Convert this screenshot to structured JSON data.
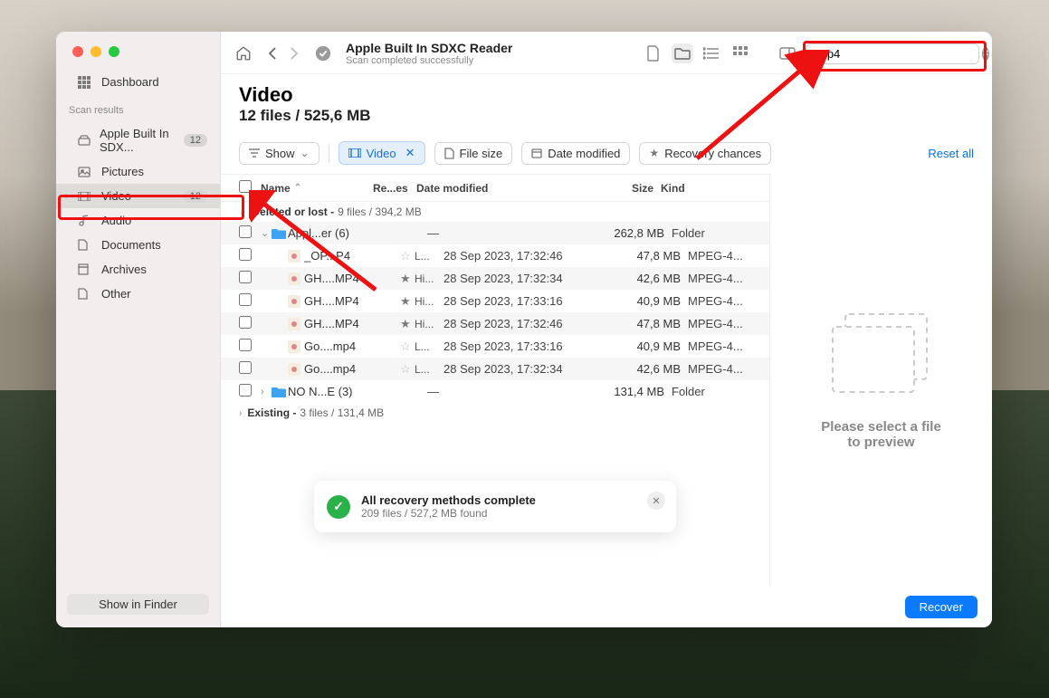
{
  "window": {
    "title": "Apple Built In SDXC Reader",
    "subtitle": "Scan completed successfully"
  },
  "search": {
    "value": "mp4"
  },
  "sidebar": {
    "dashboard": "Dashboard",
    "heading": "Scan results",
    "items": [
      {
        "label": "Apple Built In SDX...",
        "badge": "12",
        "icon": "drive"
      },
      {
        "label": "Pictures",
        "icon": "image"
      },
      {
        "label": "Video",
        "badge": "12",
        "icon": "video",
        "chev": true,
        "active": true
      },
      {
        "label": "Audio",
        "icon": "audio"
      },
      {
        "label": "Documents",
        "icon": "docs"
      },
      {
        "label": "Archives",
        "icon": "archive"
      },
      {
        "label": "Other",
        "icon": "other"
      }
    ],
    "footer": "Show in Finder"
  },
  "heading": {
    "title": "Video",
    "subtitle": "12 files / 525,6 MB"
  },
  "filters": {
    "show": "Show",
    "video": "Video",
    "filesize": "File size",
    "datemod": "Date modified",
    "recovery": "Recovery chances",
    "reset": "Reset all"
  },
  "columns": {
    "name": "Name",
    "re": "Re...es",
    "date": "Date modified",
    "size": "Size",
    "kind": "Kind"
  },
  "sections": [
    {
      "label": "Deleted or lost",
      "meta": "9 files / 394,2 MB",
      "open": true
    },
    {
      "label": "Existing",
      "meta": "3 files / 131,4 MB",
      "open": false
    }
  ],
  "rows": [
    {
      "type": "folder",
      "chev": "⌄",
      "name": "Appl...er (6)",
      "date": "—",
      "size": "262,8 MB",
      "kind": "Folder",
      "folderColor": "#3ea3f2"
    },
    {
      "type": "file",
      "name": "_OP...P4",
      "star": false,
      "re": "L...",
      "date": "28 Sep 2023, 17:32:46",
      "size": "47,8 MB",
      "kind": "MPEG-4..."
    },
    {
      "type": "file",
      "name": "GH....MP4",
      "star": true,
      "re": "Hi...",
      "date": "28 Sep 2023, 17:32:34",
      "size": "42,6 MB",
      "kind": "MPEG-4..."
    },
    {
      "type": "file",
      "name": "GH....MP4",
      "star": true,
      "re": "Hi...",
      "date": "28 Sep 2023, 17:33:16",
      "size": "40,9 MB",
      "kind": "MPEG-4..."
    },
    {
      "type": "file",
      "name": "GH....MP4",
      "star": true,
      "re": "Hi...",
      "date": "28 Sep 2023, 17:32:46",
      "size": "47,8 MB",
      "kind": "MPEG-4..."
    },
    {
      "type": "file",
      "name": "Go....mp4",
      "star": false,
      "re": "L...",
      "date": "28 Sep 2023, 17:33:16",
      "size": "40,9 MB",
      "kind": "MPEG-4..."
    },
    {
      "type": "file",
      "name": "Go....mp4",
      "star": false,
      "re": "L...",
      "date": "28 Sep 2023, 17:32:34",
      "size": "42,6 MB",
      "kind": "MPEG-4..."
    },
    {
      "type": "folder",
      "chev": "›",
      "name": "NO N...E (3)",
      "date": "—",
      "size": "131,4 MB",
      "kind": "Folder",
      "folderColor": "#3ea3f2"
    }
  ],
  "preview": {
    "text1": "Please select a file",
    "text2": "to preview"
  },
  "toast": {
    "title": "All recovery methods complete",
    "sub": "209 files / 527,2 MB found"
  },
  "recover": "Recover"
}
